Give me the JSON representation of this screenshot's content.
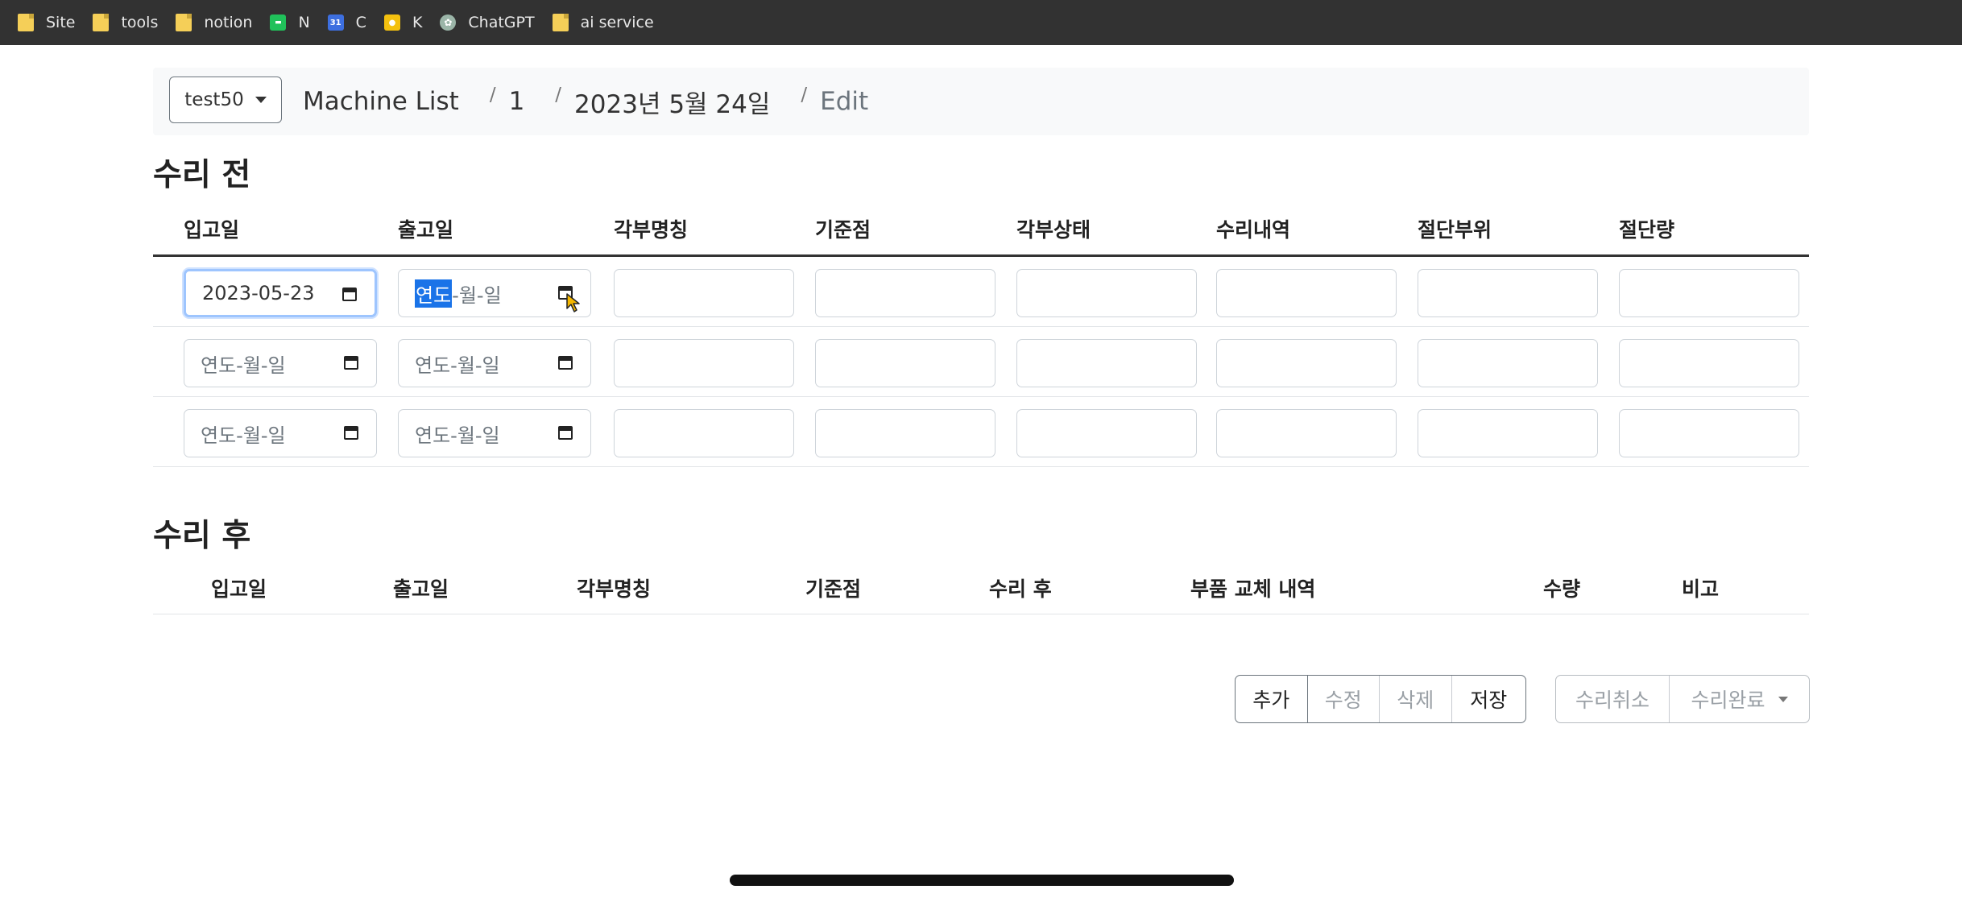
{
  "bookmarks": [
    {
      "label": "Site",
      "icon": "folder-icon"
    },
    {
      "label": "tools",
      "icon": "folder-icon"
    },
    {
      "label": "notion",
      "icon": "folder-icon"
    },
    {
      "label": "N",
      "icon": "n-icon"
    },
    {
      "label": "C",
      "icon": "calendar-icon"
    },
    {
      "label": "K",
      "icon": "k-icon"
    },
    {
      "label": "ChatGPT",
      "icon": "chatgpt-icon"
    },
    {
      "label": "ai service",
      "icon": "folder-icon"
    }
  ],
  "topbar": {
    "account": "test50",
    "breadcrumb": [
      "Machine List",
      "1",
      "2023년 5월 24일",
      "Edit"
    ]
  },
  "before": {
    "title": "수리 전",
    "headers": [
      "입고일",
      "출고일",
      "각부명칭",
      "기준점",
      "각부상태",
      "수리내역",
      "절단부위",
      "절단량"
    ],
    "rows": [
      {
        "in_date": "2023-05-23",
        "out_date_parts": [
          "연도",
          "-월-일"
        ]
      },
      {
        "in_date": "연도-월-일",
        "out_date": "연도-월-일"
      },
      {
        "in_date": "연도-월-일",
        "out_date": "연도-월-일"
      }
    ]
  },
  "after": {
    "title": "수리 후",
    "headers": [
      "입고일",
      "출고일",
      "각부명칭",
      "기준점",
      "수리 후",
      "부품 교체 내역",
      "수량",
      "비고"
    ]
  },
  "actions": {
    "add": "추가",
    "edit": "수정",
    "delete": "삭제",
    "save": "저장",
    "cancel_repair": "수리취소",
    "complete_repair": "수리완료"
  }
}
